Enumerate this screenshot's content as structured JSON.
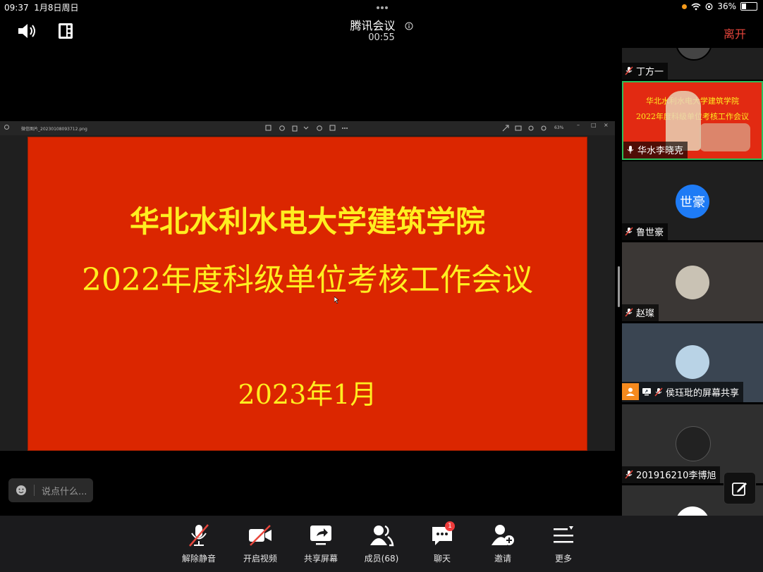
{
  "status_bar": {
    "time": "09:37",
    "date": "1月8日周日",
    "battery": "36%",
    "battery_level": 0.36
  },
  "header": {
    "title": "腾讯会议",
    "timer": "00:55",
    "leave_label": "离开"
  },
  "viewer": {
    "filename": "微信图片_20230108093712.png",
    "zoom": "63%"
  },
  "slide": {
    "line1": "华北水利水电大学建筑学院",
    "line2": "2022年度科级单位考核工作会议",
    "line3": "2023年1月"
  },
  "chat": {
    "placeholder": "说点什么..."
  },
  "participants": [
    {
      "name": "丁方一"
    },
    {
      "name": "华水李晓克",
      "slide_line1": "华北水利水电大学建筑学院",
      "slide_line2": "2022年度科级单位考核工作会议"
    },
    {
      "name": "鲁世豪",
      "avatar_text": "世豪",
      "avatar_color": "#1e7bf5"
    },
    {
      "name": "赵璨"
    },
    {
      "name": "侯珏玭的屏幕共享"
    },
    {
      "name": "201916210李博旭"
    }
  ],
  "toolbar": {
    "unmute": "解除静音",
    "video": "开启视频",
    "share": "共享屏幕",
    "members": "成员(68)",
    "chat": "聊天",
    "chat_badge": "1",
    "invite": "邀请",
    "more": "更多"
  },
  "colors": {
    "accent": "#1e7bf5",
    "leave": "#e8463c",
    "slide_bg": "#db2600",
    "slide_text": "#ffee20",
    "active_border": "#2bbf5a"
  }
}
